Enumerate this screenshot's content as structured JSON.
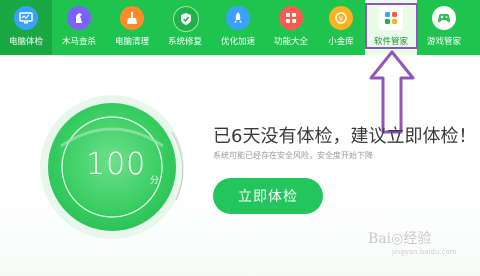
{
  "nav": {
    "items": [
      {
        "label": "电脑体检",
        "icon": "monitor-icon",
        "color": "#3aa1ff"
      },
      {
        "label": "木马查杀",
        "icon": "horse-icon",
        "color": "#7b61ff"
      },
      {
        "label": "电脑清理",
        "icon": "broom-icon",
        "color": "#ff8a2b"
      },
      {
        "label": "系统修复",
        "icon": "shield-icon",
        "color": "#22b04a"
      },
      {
        "label": "优化加速",
        "icon": "rocket-icon",
        "color": "#3aa1ff"
      },
      {
        "label": "功能大全",
        "icon": "grid-icon",
        "color": "#ff5a4f"
      },
      {
        "label": "小金库",
        "icon": "coin-icon",
        "color": "#ffb21e"
      },
      {
        "label": "软件管家",
        "icon": "apps-icon",
        "color": "#ffffff"
      },
      {
        "label": "游戏管家",
        "icon": "gamepad-icon",
        "color": "#2fbd58"
      }
    ]
  },
  "main": {
    "score": "100",
    "score_unit": "分",
    "headline": "已6天没有体检，建议立即体检！",
    "subtext": "系统可能已经存在安全风险，安全度开始下降",
    "check_button": "立即体检"
  },
  "watermark": {
    "brand": "Bai◎经验",
    "url": "jingyan.baidu.com"
  },
  "colors": {
    "topbar": "#1fc44e",
    "accent": "#22c65c",
    "annotation": "#8e56b8"
  }
}
